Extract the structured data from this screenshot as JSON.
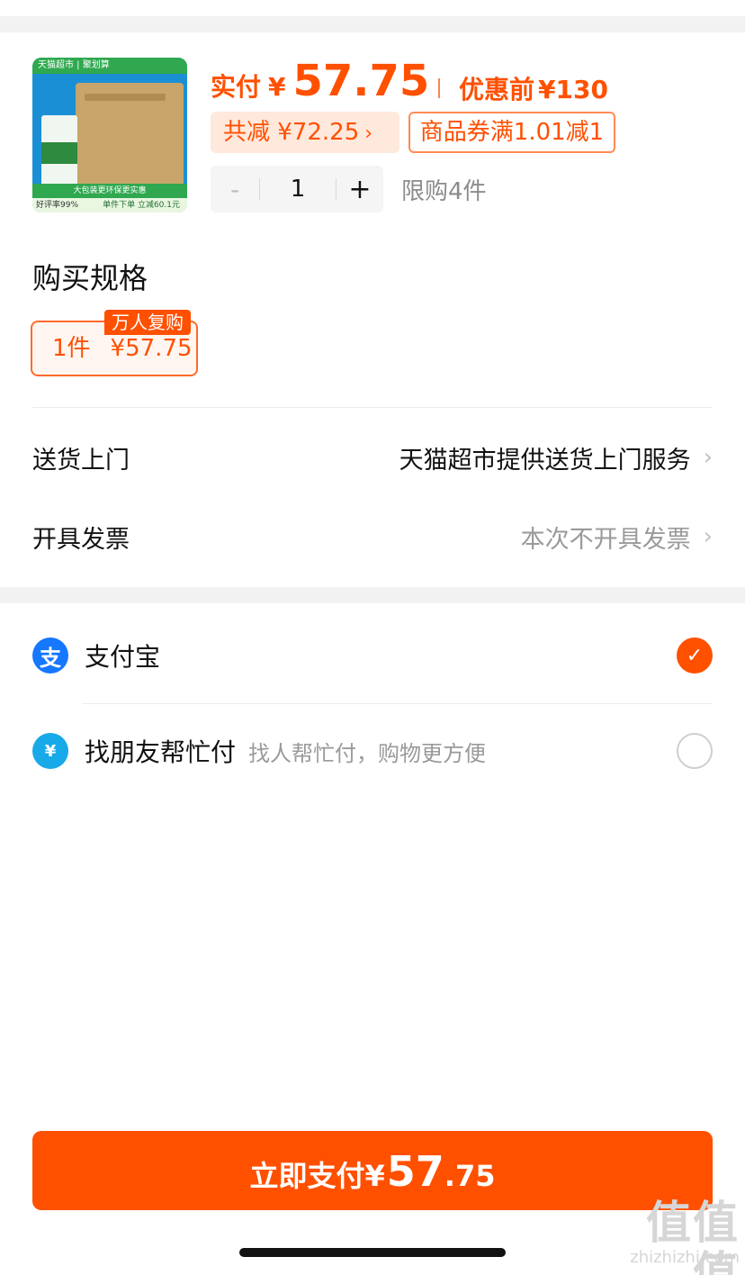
{
  "product": {
    "image_top_text": "天猫超市 | 聚划算",
    "image_banner1": "大包装更环保更实惠",
    "image_banner2": "单件下单 立减60.1元",
    "image_rating": "好评率99%"
  },
  "price": {
    "pay_label": "实付",
    "currency": "¥",
    "pay_amount": "57.75",
    "before_label": "优惠前",
    "before_amount": "¥130",
    "discount_label": "共减 ¥72.25",
    "coupon_label": "商品券满1.01减1"
  },
  "quantity": {
    "minus": "-",
    "value": "1",
    "plus": "+",
    "limit_text": "限购4件"
  },
  "spec": {
    "title": "购买规格",
    "option_qty": "1件",
    "option_price": "¥57.75",
    "badge": "万人复购"
  },
  "delivery": {
    "label": "送货上门",
    "value": "天猫超市提供送货上门服务"
  },
  "invoice": {
    "label": "开具发票",
    "value": "本次不开具发票"
  },
  "payment": {
    "alipay": {
      "name": "支付宝",
      "icon_glyph": "支",
      "icon": "alipay-icon",
      "selected": true
    },
    "friend": {
      "name": "找朋友帮忙付",
      "desc": "找人帮忙付，购物更方便",
      "icon_glyph": "¥",
      "icon": "friend-pay-icon",
      "selected": false
    }
  },
  "pay_button": {
    "label": "立即支付¥",
    "amount_int": "57",
    "amount_dec": ".75"
  },
  "watermark": {
    "text": "值值值",
    "url": "zhizhizhi.com"
  },
  "colors": {
    "accent": "#ff5000",
    "alipay_blue": "#1677ff",
    "friend_blue": "#18a9e8"
  }
}
